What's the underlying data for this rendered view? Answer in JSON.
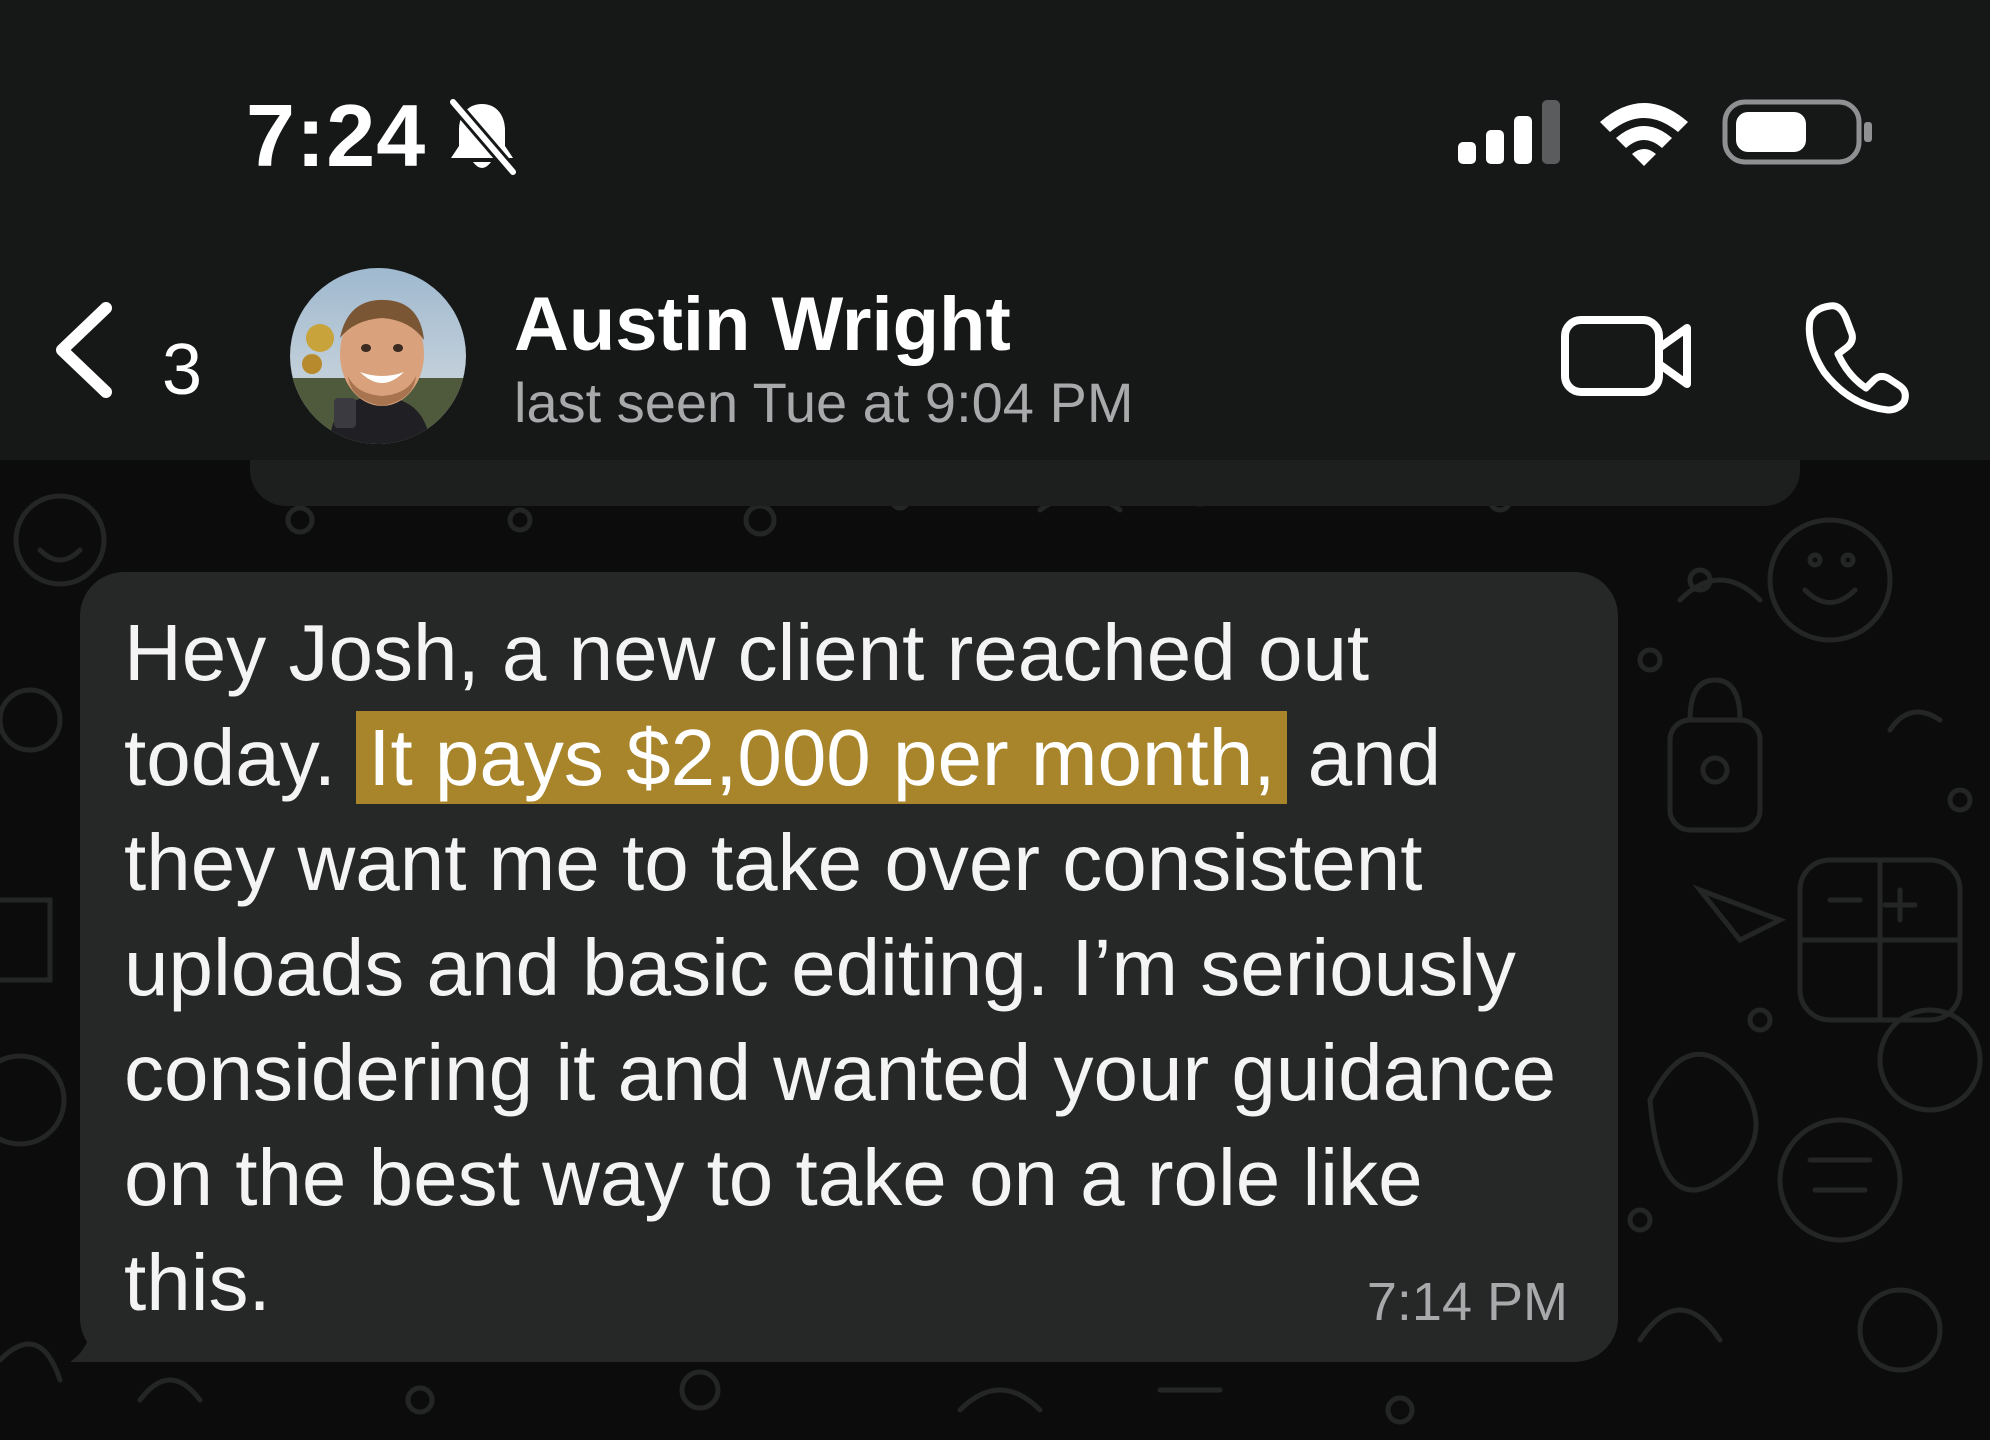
{
  "status_bar": {
    "time": "7:24",
    "icons": [
      "bell-slash-icon",
      "cellular-signal-icon",
      "wifi-icon",
      "battery-icon"
    ]
  },
  "header": {
    "back_icon": "chevron-left-icon",
    "unread_count": "3",
    "contact_name": "Austin Wright",
    "contact_status": "last seen Tue at 9:04 PM",
    "actions": [
      "video-camera-icon",
      "phone-icon"
    ]
  },
  "message": {
    "text_before": "Hey Josh, a new client reached out today. ",
    "text_highlight": "It pays $2,000 per month,",
    "text_after": " and they want me to take over consistent uploads and basic editing. I’m seriously considering it and wanted your guidance on the best way to take on a role like this.",
    "time": "7:14 PM"
  },
  "colors": {
    "header_bg": "#161818",
    "chat_bg": "#0c0c0c",
    "bubble_bg": "#262828",
    "highlight": "#a8842a",
    "secondary_text": "#a7a9ab"
  }
}
